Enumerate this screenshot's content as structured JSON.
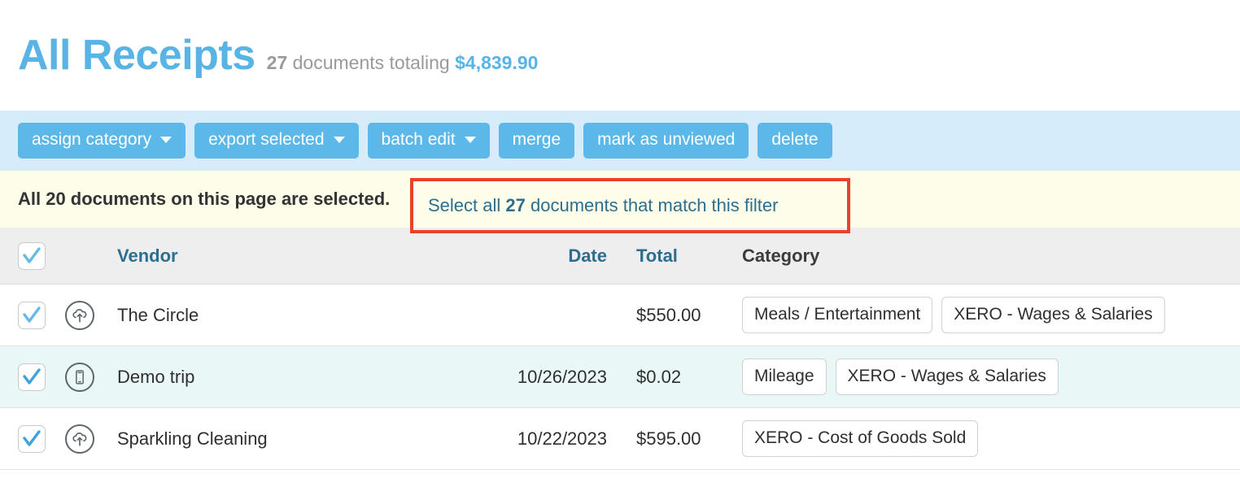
{
  "header": {
    "title": "All Receipts",
    "count": "27",
    "documents_word": "documents totaling",
    "total_amount": "$4,839.90"
  },
  "toolbar": {
    "buttons": [
      {
        "label": "assign category",
        "has_caret": true
      },
      {
        "label": "export selected",
        "has_caret": true
      },
      {
        "label": "batch edit",
        "has_caret": true
      },
      {
        "label": "merge",
        "has_caret": false
      },
      {
        "label": "mark as unviewed",
        "has_caret": false
      },
      {
        "label": "delete",
        "has_caret": false
      }
    ]
  },
  "banner": {
    "message": "All 20 documents on this page are selected.",
    "link_prefix": "Select all ",
    "link_count": "27",
    "link_suffix": " documents that match this filter",
    "highlight_color": "#e8432a"
  },
  "table": {
    "columns": {
      "vendor": "Vendor",
      "date": "Date",
      "total": "Total",
      "category": "Category"
    },
    "rows": [
      {
        "checked": true,
        "source_icon": "cloud-upload-icon",
        "vendor": "The Circle",
        "date": "",
        "total": "$550.00",
        "categories": [
          "Meals / Entertainment",
          "XERO - Wages & Salaries"
        ]
      },
      {
        "checked": true,
        "source_icon": "mobile-phone-icon",
        "vendor": "Demo trip",
        "date": "10/26/2023",
        "total": "$0.02",
        "categories": [
          "Mileage",
          "XERO - Wages & Salaries"
        ]
      },
      {
        "checked": true,
        "source_icon": "cloud-upload-icon",
        "vendor": "Sparkling Cleaning",
        "date": "10/22/2023",
        "total": "$595.00",
        "categories": [
          "XERO - Cost of Goods Sold"
        ]
      }
    ]
  },
  "colors": {
    "brand_blue": "#58b4e5",
    "toolbar_bg": "#d6ecfa",
    "banner_bg": "#fdfdea",
    "link_blue": "#2d6e8e",
    "highlight_red": "#e8432a"
  }
}
